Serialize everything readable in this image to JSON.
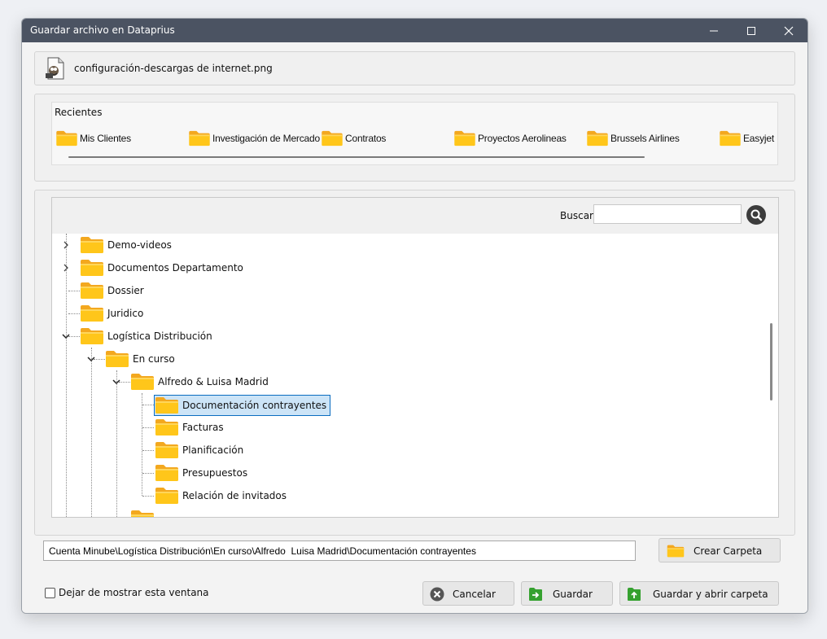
{
  "window": {
    "title": "Guardar archivo en Dataprius"
  },
  "file": {
    "name": "configuración-descargas de internet.png"
  },
  "recent": {
    "label": "Recientes",
    "items": [
      "Mis Clientes",
      "Investigación de Mercado",
      "Contratos",
      "Proyectos Aerolineas",
      "Brussels Airlines",
      "Easyjet"
    ]
  },
  "search": {
    "label": "Buscar",
    "value": ""
  },
  "tree": {
    "items": [
      "Demo-videos",
      "Documentos Departamento",
      "Dossier",
      "Juridico",
      "Logística Distribución",
      "En curso",
      "Alfredo & Luisa Madrid",
      "Documentación contrayentes",
      "Facturas",
      "Planificación",
      "Presupuestos",
      "Relación de invitados"
    ],
    "selected": "Documentación contrayentes"
  },
  "path": {
    "value": "Cuenta Minube\\Logística Distribución\\En curso\\Alfredo  Luisa Madrid\\Documentación contrayentes"
  },
  "buttons": {
    "create_folder": "Crear Carpeta",
    "cancel": "Cancelar",
    "save": "Guardar",
    "save_open": "Guardar y abrir carpeta"
  },
  "options": {
    "dont_show": "Dejar de mostrar esta ventana",
    "dont_show_checked": false
  },
  "colors": {
    "titlebar": "#4b5362",
    "folder": "#ffc61a",
    "folder_tab": "#f3a81f",
    "selection": "#cce4f7",
    "selection_border": "#0b6cc0",
    "save_icon": "#35a12f"
  },
  "icons": {
    "file": "image-file-icon",
    "folder": "folder-icon",
    "search": "search-icon",
    "cancel": "cancel-icon",
    "save": "save-arrow-icon",
    "save_open": "save-open-arrow-icon"
  }
}
